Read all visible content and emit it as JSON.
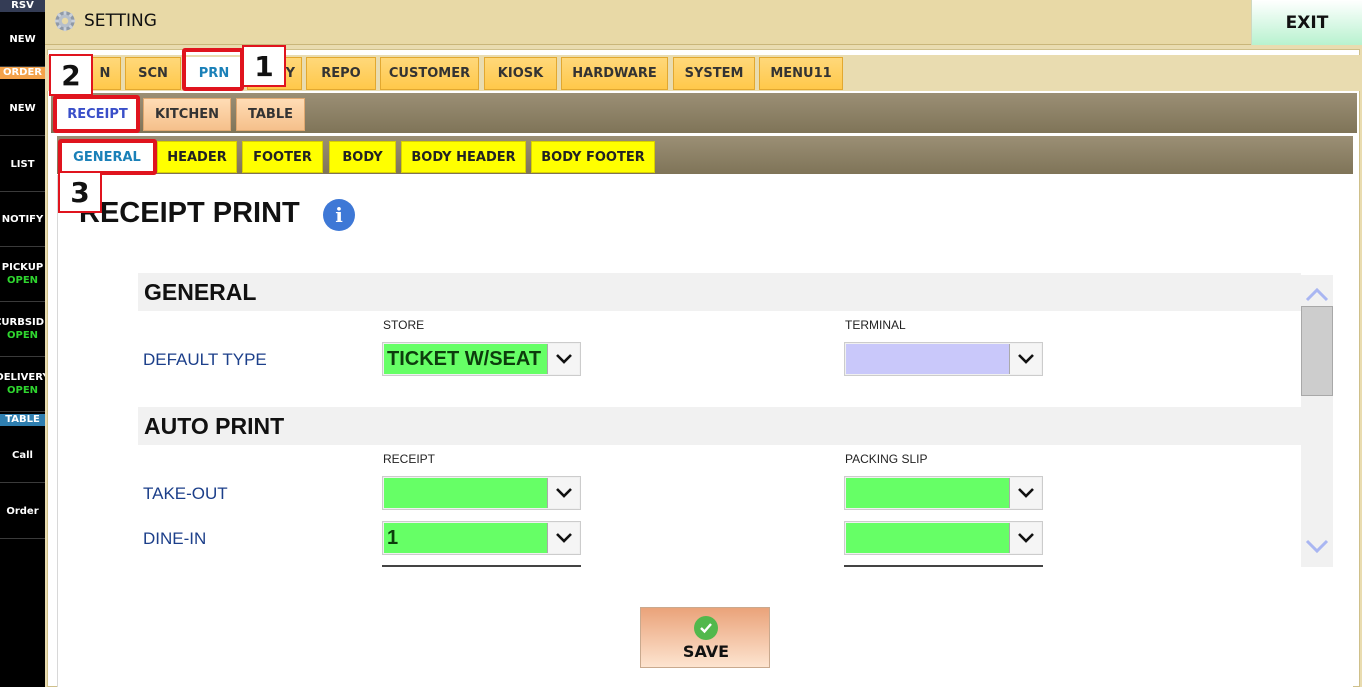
{
  "sidebar": {
    "rsv_label": "RSV",
    "new_top": "NEW",
    "order_label": "ORDER",
    "new_order": "NEW",
    "list": "LIST",
    "notify": "NOTIFY",
    "pickup": "PICKUP",
    "pickup_status": "OPEN",
    "curbside": "CURBSIDE",
    "curbside_status": "OPEN",
    "delivery": "DELIVERY",
    "delivery_status": "OPEN",
    "table_label": "TABLE",
    "call": "Call",
    "order": "Order"
  },
  "header": {
    "title": "SETTING",
    "exit_label": "EXIT"
  },
  "main_tabs": [
    "N",
    "SCN",
    "PRN",
    "Y",
    "REPO",
    "CUSTOMER",
    "KIOSK",
    "HARDWARE",
    "SYSTEM",
    "MENU11"
  ],
  "sub_tabs": [
    "RECEIPT",
    "KITCHEN",
    "TABLE"
  ],
  "section_tabs": [
    "GENERAL",
    "HEADER",
    "FOOTER",
    "BODY",
    "BODY HEADER",
    "BODY FOOTER"
  ],
  "page_title": "RECEIPT PRINT",
  "general": {
    "title": "GENERAL",
    "col_store": "STORE",
    "col_terminal": "TERMINAL",
    "default_type_label": "DEFAULT TYPE",
    "default_type_store": "TICKET W/SEAT",
    "default_type_terminal": ""
  },
  "auto_print": {
    "title": "AUTO PRINT",
    "col_receipt": "RECEIPT",
    "col_packing": "PACKING SLIP",
    "takeout_label": "TAKE-OUT",
    "takeout_receipt": "",
    "takeout_packing": "",
    "dinein_label": "DINE-IN",
    "dinein_receipt": "1",
    "dinein_packing": ""
  },
  "save_label": "SAVE",
  "callouts": {
    "one": "1",
    "two": "2",
    "three": "3"
  },
  "colors": {
    "accent_green": "#66ff66",
    "tab_yellow": "#ffff00",
    "callout_red": "#e0141e"
  }
}
